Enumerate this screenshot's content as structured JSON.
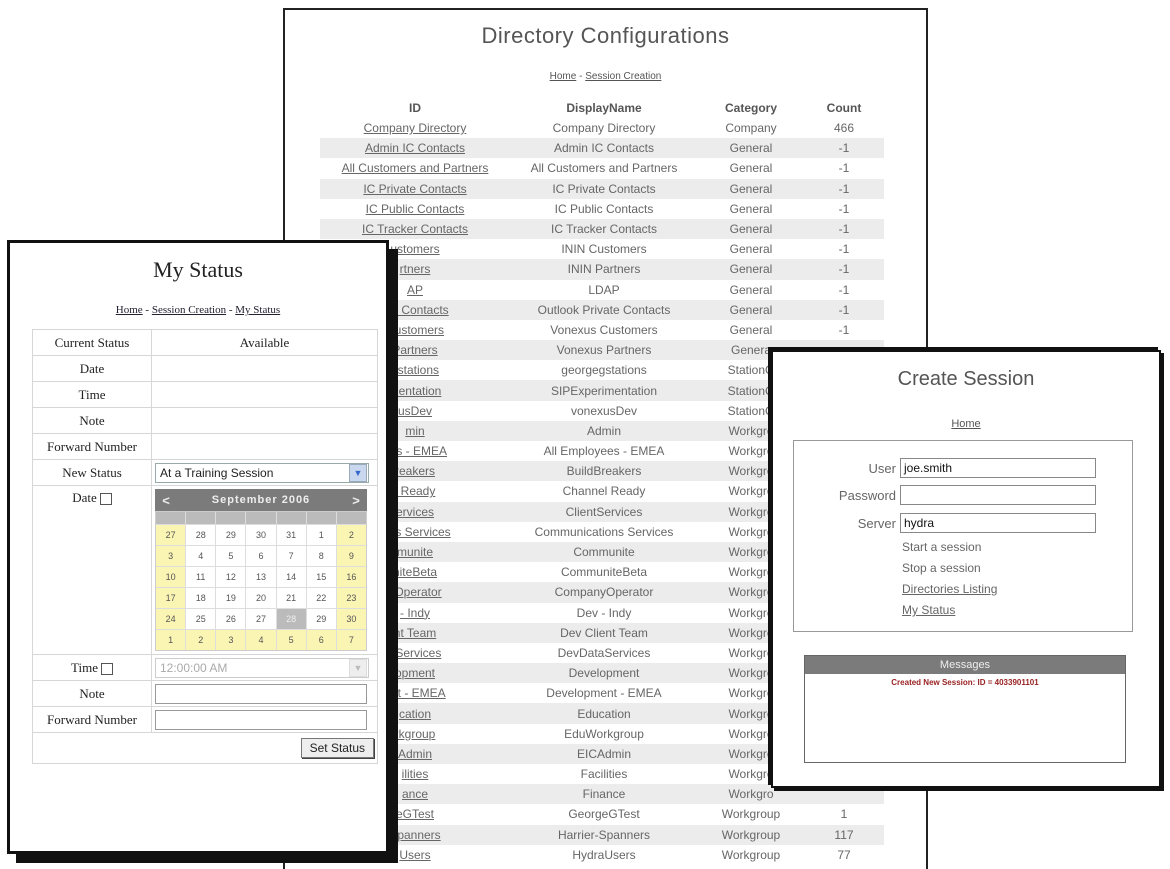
{
  "directory": {
    "title": "Directory Configurations",
    "crumbs": [
      "Home",
      "Session Creation"
    ],
    "columns": [
      "ID",
      "DisplayName",
      "Category",
      "Count"
    ],
    "rows": [
      [
        "Company Directory",
        "Company Directory",
        "Company",
        "466"
      ],
      [
        "Admin IC Contacts",
        "Admin IC Contacts",
        "General",
        "-1"
      ],
      [
        "All Customers and Partners",
        "All Customers and Partners",
        "General",
        "-1"
      ],
      [
        "IC Private Contacts",
        "IC Private Contacts",
        "General",
        "-1"
      ],
      [
        "IC Public Contacts",
        "IC Public Contacts",
        "General",
        "-1"
      ],
      [
        "IC Tracker Contacts",
        "IC Tracker Contacts",
        "General",
        "-1"
      ],
      [
        "ustomers",
        "ININ Customers",
        "General",
        "-1"
      ],
      [
        "rtners",
        "ININ Partners",
        "General",
        "-1"
      ],
      [
        "AP",
        "LDAP",
        "General",
        "-1"
      ],
      [
        "ate Contacts",
        "Outlook Private Contacts",
        "General",
        "-1"
      ],
      [
        "Customers",
        "Vonexus Customers",
        "General",
        "-1"
      ],
      [
        "Partners",
        "Vonexus Partners",
        "Genera",
        ""
      ],
      [
        "gstations",
        "georgegstations",
        "StationG",
        ""
      ],
      [
        "mentation",
        "SIPExperimentation",
        "StationG",
        ""
      ],
      [
        "usDev",
        "vonexusDev",
        "StationG",
        ""
      ],
      [
        "min",
        "Admin",
        "Workgro",
        ""
      ],
      [
        "ees - EMEA",
        "All Employees - EMEA",
        "Workgro",
        ""
      ],
      [
        "reakers",
        "BuildBreakers",
        "Workgro",
        ""
      ],
      [
        "l Ready",
        "Channel Ready",
        "Workgro",
        ""
      ],
      [
        "ervices",
        "ClientServices",
        "Workgro",
        ""
      ],
      [
        "ions Services",
        "Communications Services",
        "Workgro",
        ""
      ],
      [
        "munite",
        "Communite",
        "Workgro",
        ""
      ],
      [
        "niteBeta",
        "CommuniteBeta",
        "Workgro",
        ""
      ],
      [
        "vOperator",
        "CompanyOperator",
        "Workgro",
        ""
      ],
      [
        "- Indy",
        "Dev - Indy",
        "Workgro",
        ""
      ],
      [
        "nt Team",
        "Dev Client Team",
        "Workgro",
        ""
      ],
      [
        "aServices",
        "DevDataServices",
        "Workgro",
        ""
      ],
      [
        "opment",
        "Development",
        "Workgro",
        ""
      ],
      [
        "ent - EMEA",
        "Development - EMEA",
        "Workgro",
        ""
      ],
      [
        "cation",
        "Education",
        "Workgro",
        ""
      ],
      [
        "rkgroup",
        "EduWorkgroup",
        "Workgro",
        ""
      ],
      [
        "Admin",
        "EICAdmin",
        "Workgro",
        ""
      ],
      [
        "ilities",
        "Facilities",
        "Workgro",
        ""
      ],
      [
        "ance",
        "Finance",
        "Workgro",
        ""
      ],
      [
        "eGTest",
        "GeorgeGTest",
        "Workgroup",
        "1"
      ],
      [
        "Spanners",
        "Harrier-Spanners",
        "Workgroup",
        "117"
      ],
      [
        "Users",
        "HydraUsers",
        "Workgroup",
        "77"
      ]
    ]
  },
  "status": {
    "title": "My Status",
    "crumbs": [
      "Home",
      "Session Creation",
      "My Status"
    ],
    "current_status_label": "Current Status",
    "current_status_value": "Available",
    "date_label": "Date",
    "time_label": "Time",
    "note_label": "Note",
    "forward_label": "Forward Number",
    "new_status_label": "New Status",
    "new_status_value": "At a Training Session",
    "calendar": {
      "month": "September 2006",
      "prev": "<",
      "next": ">",
      "weeks": [
        [
          "27",
          "28",
          "29",
          "30",
          "31",
          "1",
          "2"
        ],
        [
          "3",
          "4",
          "5",
          "6",
          "7",
          "8",
          "9"
        ],
        [
          "10",
          "11",
          "12",
          "13",
          "14",
          "15",
          "16"
        ],
        [
          "17",
          "18",
          "19",
          "20",
          "21",
          "22",
          "23"
        ],
        [
          "24",
          "25",
          "26",
          "27",
          "28",
          "29",
          "30"
        ],
        [
          "1",
          "2",
          "3",
          "4",
          "5",
          "6",
          "7"
        ]
      ]
    },
    "time_value": "12:00:00 AM",
    "set_button": "Set Status"
  },
  "session": {
    "title": "Create Session",
    "home": "Home",
    "user_label": "User",
    "user_value": "joe.smith",
    "password_label": "Password",
    "server_label": "Server",
    "server_value": "hydra",
    "start_link": "Start a session",
    "stop_link": "Stop a session",
    "dir_link": "Directories Listing",
    "status_link": "My Status",
    "messages_title": "Messages",
    "message": "Created New Session: ID = 4033901101"
  }
}
